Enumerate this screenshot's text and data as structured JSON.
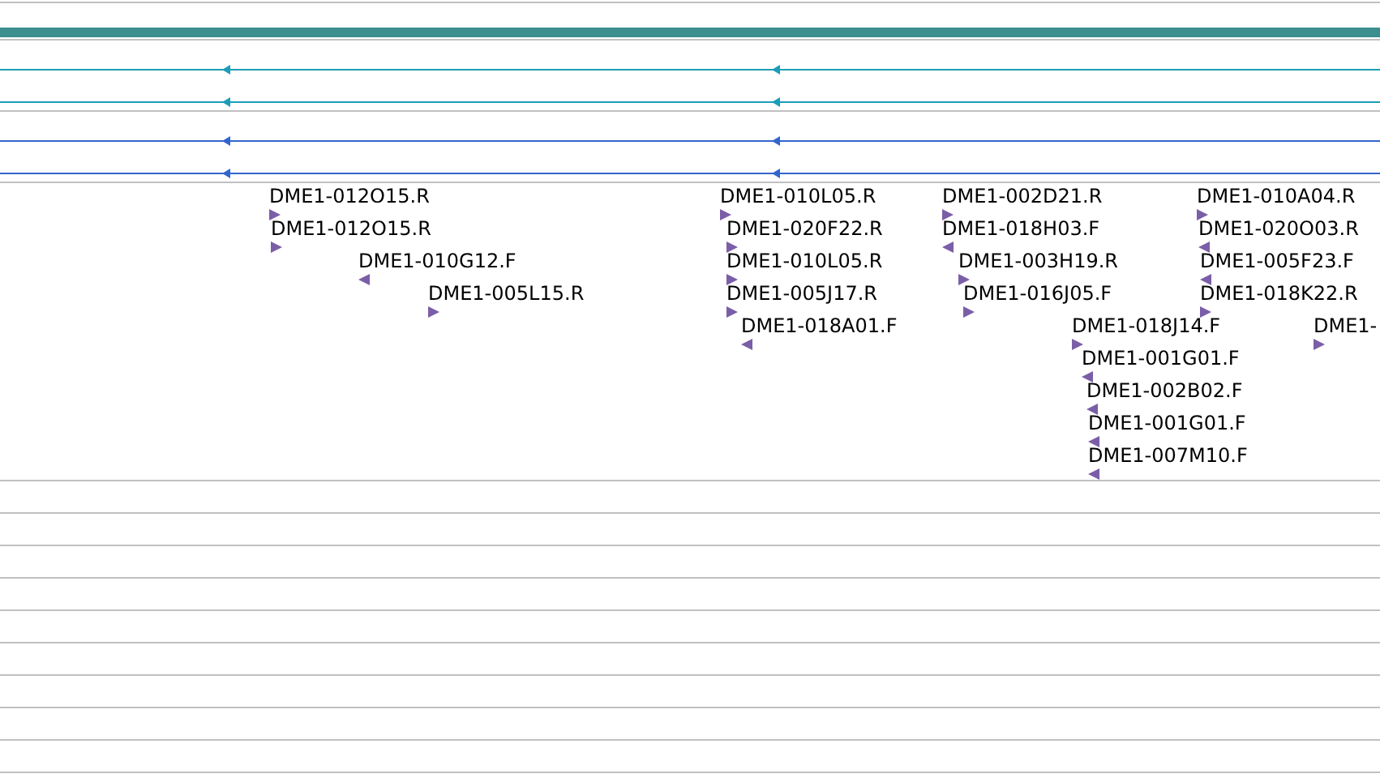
{
  "alignment_tracks": [
    {
      "color": "#1b9db8",
      "rows": [
        {
          "forward": false
        },
        {
          "forward": false
        }
      ]
    },
    {
      "color": "#3366cc",
      "rows": [
        {
          "forward": false
        },
        {
          "forward": false
        }
      ]
    }
  ],
  "clones": [
    {
      "label": "DME1-012O15.R",
      "forward": true
    },
    {
      "label": "DME1-012O15.R",
      "forward": true
    },
    {
      "label": "DME1-010G12.F",
      "forward": false
    },
    {
      "label": "DME1-005L15.R",
      "forward": true
    },
    {
      "label": "DME1-010L05.R",
      "forward": true
    },
    {
      "label": "DME1-020F22.R",
      "forward": true
    },
    {
      "label": "DME1-010L05.R",
      "forward": true
    },
    {
      "label": "DME1-005J17.R",
      "forward": true
    },
    {
      "label": "DME1-018A01.F",
      "forward": false
    },
    {
      "label": "DME1-002D21.R",
      "forward": true
    },
    {
      "label": "DME1-018H03.F",
      "forward": false
    },
    {
      "label": "DME1-003H19.R",
      "forward": true
    },
    {
      "label": "DME1-016J05.F",
      "forward": true
    },
    {
      "label": "DME1-018J14.F",
      "forward": true
    },
    {
      "label": "DME1-001G01.F",
      "forward": false
    },
    {
      "label": "DME1-002B02.F",
      "forward": false
    },
    {
      "label": "DME1-001G01.F",
      "forward": false
    },
    {
      "label": "DME1-007M10.F",
      "forward": false
    },
    {
      "label": "DME1-010A04.R",
      "forward": true
    },
    {
      "label": "DME1-020O03.R",
      "forward": false
    },
    {
      "label": "DME1-005F23.F",
      "forward": false
    },
    {
      "label": "DME1-018K22.R",
      "forward": true
    },
    {
      "label": "DME1-",
      "forward": true
    }
  ]
}
